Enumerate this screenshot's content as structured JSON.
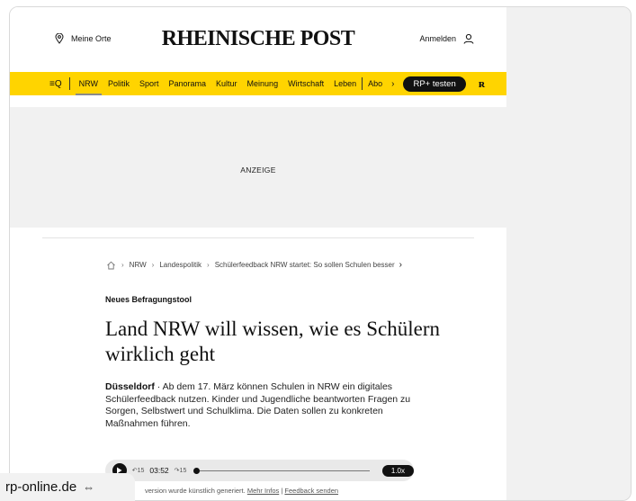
{
  "header": {
    "location_label": "Meine Orte",
    "logo_text": "RHEINISCHE POST",
    "login_label": "Anmelden"
  },
  "nav": {
    "menu_icon_text": "≡Q",
    "items": [
      "NRW",
      "Politik",
      "Sport",
      "Panorama",
      "Kultur",
      "Meinung",
      "Wirtschaft",
      "Leben"
    ],
    "abo_label": "Abo",
    "cta_label": "RP+ testen",
    "brand_icon_text": "ʀ"
  },
  "ad": {
    "label": "ANZEIGE"
  },
  "breadcrumb": {
    "items": [
      "NRW",
      "Landespolitik",
      "Schülerfeedback NRW startet: So sollen Schulen besser"
    ]
  },
  "article": {
    "kicker": "Neues Befragungstool",
    "headline": "Land NRW will wissen, wie es Schülern wirklich geht",
    "dateline": "Düsseldorf",
    "lead": " · Ab dem 17. März können Schulen in NRW ein digitales Schülerfeedback nutzen. Kinder und Jugendliche beantworten Fragen zu Sorgen, Selbstwert und Schulklima. Die Daten sollen zu konkreten Maßnahmen führen."
  },
  "player": {
    "skip_back_label": "15",
    "time": "03:52",
    "skip_forward_label": "15",
    "speed": "1.0x",
    "progress": 0
  },
  "audio_note": {
    "text": "version wurde künstlich generiert.",
    "more_info": "Mehr Infos",
    "separator": "|",
    "feedback": "Feedback senden"
  },
  "source_badge": {
    "domain": "rp-online.de",
    "icon": "link-icon"
  }
}
